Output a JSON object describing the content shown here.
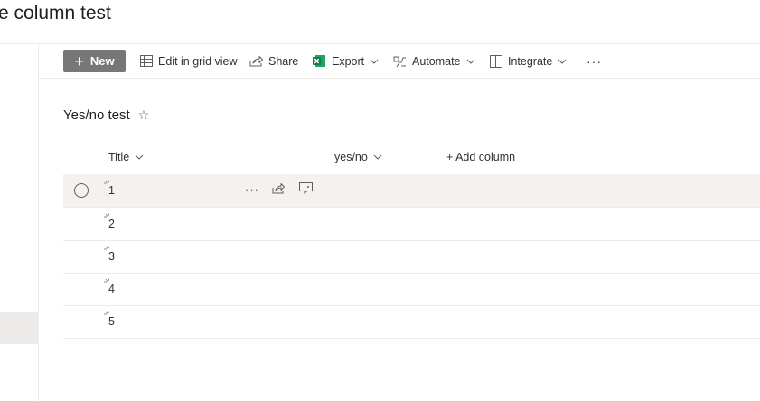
{
  "page": {
    "title": "e column test"
  },
  "commandbar": {
    "new_label": "New",
    "edit_grid_label": "Edit in grid view",
    "share_label": "Share",
    "export_label": "Export",
    "automate_label": "Automate",
    "integrate_label": "Integrate",
    "more_label": "···"
  },
  "list": {
    "title": "Yes/no test"
  },
  "columns": {
    "title": "Title",
    "yesno": "yes/no",
    "add_column": "+ Add column"
  },
  "rows": [
    {
      "title": "1"
    },
    {
      "title": "2"
    },
    {
      "title": "3"
    },
    {
      "title": "4"
    },
    {
      "title": "5"
    }
  ],
  "row_actions": {
    "more_label": "···"
  },
  "colors": {
    "new_button_bg": "#797775",
    "excel_green": "#107c41",
    "hover_row": "#f3f2f1"
  }
}
